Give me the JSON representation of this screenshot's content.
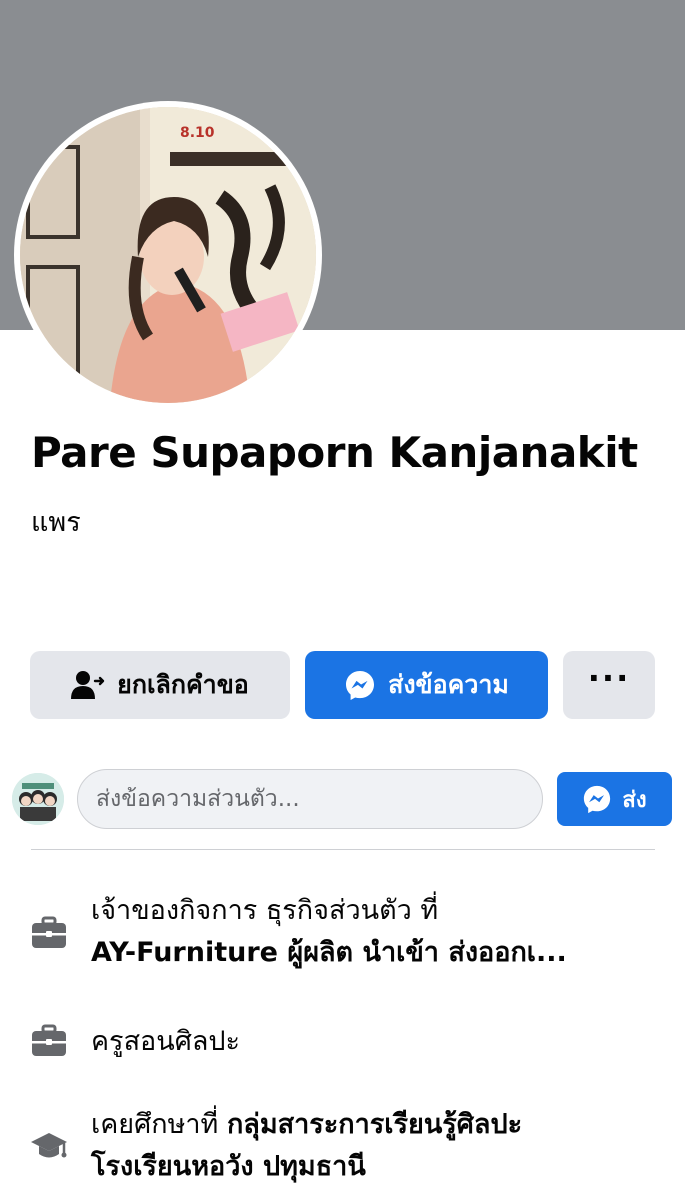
{
  "profile": {
    "name": "Pare Supaporn Kanjanakit",
    "nickname": "แพร"
  },
  "actions": {
    "cancel_request_label": "ยกเลิกคำขอ",
    "message_label": "ส่งข้อความ",
    "more_label": "···"
  },
  "private_message": {
    "placeholder": "ส่งข้อความส่วนตัว...",
    "send_label": "ส่ง"
  },
  "info": {
    "work1_prefix": "เจ้าของกิจการ ธุรกิจส่วนตัว ที่",
    "work1_place": "AY-Furniture ผู้ผลิต นำเข้า ส่งออกเ...",
    "work2": "ครูสอนศิลปะ",
    "edu_prefix": "เคยศึกษาที่ ",
    "edu_place_line1": "กลุ่มสาระการเรียนรู้ศิลปะ",
    "edu_place_line2": "โรงเรียนหอวัง ปทุมธานี"
  },
  "icons": {
    "cancel_request": "person-arrow-icon",
    "messenger": "messenger-icon",
    "more": "more-dots-icon",
    "work": "briefcase-icon",
    "education": "graduation-cap-icon"
  },
  "colors": {
    "cover": "#8a8d91",
    "primary": "#1b74e4",
    "secondary_button": "#e4e6eb",
    "icon_gray": "#65676b"
  }
}
